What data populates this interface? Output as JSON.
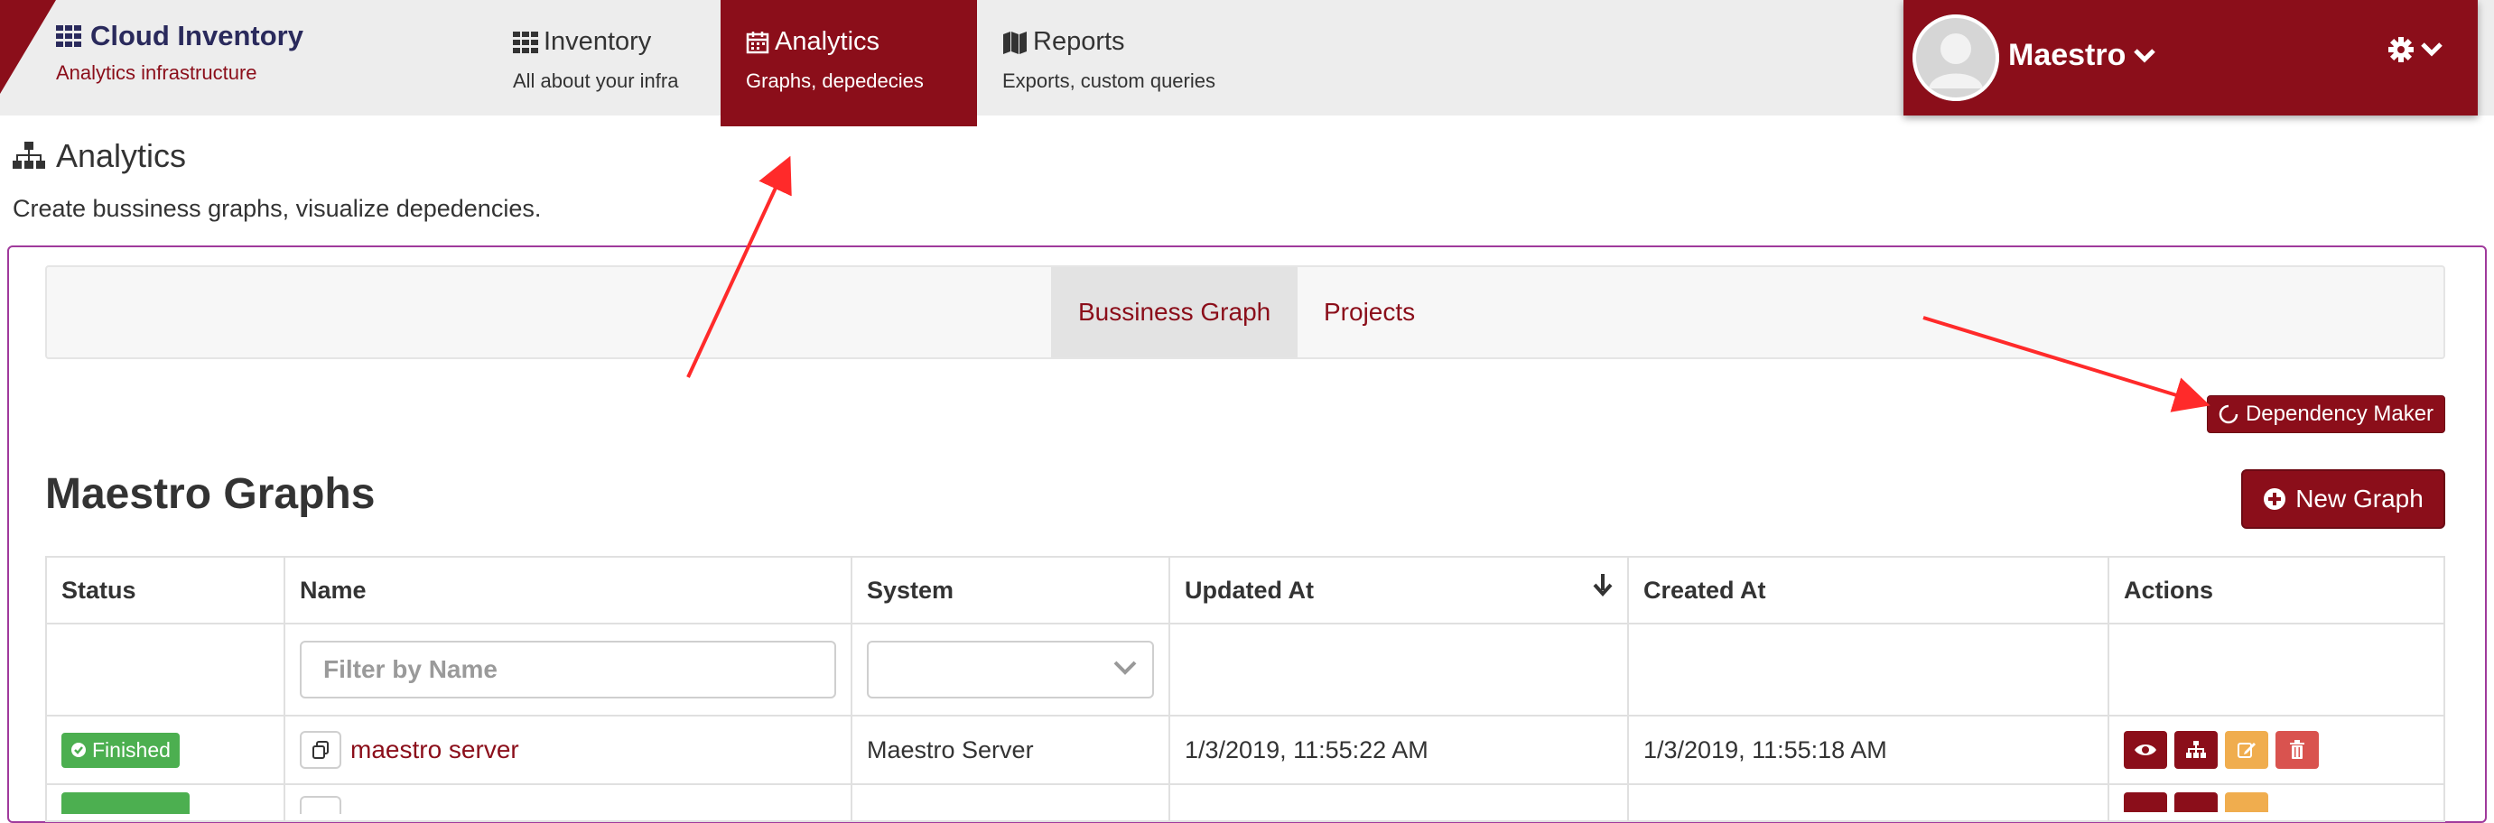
{
  "brand": {
    "title": "Cloud Inventory",
    "subtitle": "Analytics infrastructure"
  },
  "nav": [
    {
      "title": "Inventory",
      "subtitle": "All about your infra",
      "icon": "grid-icon"
    },
    {
      "title": "Analytics",
      "subtitle": "Graphs, depedecies",
      "icon": "calendar-icon",
      "active": true
    },
    {
      "title": "Reports",
      "subtitle": "Exports, custom queries",
      "icon": "map-icon"
    }
  ],
  "user": {
    "name": "Maestro"
  },
  "page": {
    "title": "Analytics",
    "description": "Create bussiness graphs, visualize depedencies."
  },
  "tabs": [
    {
      "label": "Bussiness Graph",
      "active": true
    },
    {
      "label": "Projects"
    }
  ],
  "dependency_button": "Dependency Maker",
  "graphs": {
    "title": "Maestro Graphs",
    "new_button": "New Graph",
    "columns": [
      "Status",
      "Name",
      "System",
      "Updated At",
      "Created At",
      "Actions"
    ],
    "filter_placeholder": "Filter by Name",
    "rows": [
      {
        "status": "Finished",
        "name": "maestro server",
        "system": "Maestro Server",
        "updated": "1/3/2019, 11:55:22 AM",
        "created": "1/3/2019, 11:55:18 AM"
      }
    ]
  },
  "colors": {
    "brand": "#8b0e1a",
    "success": "#4caf50",
    "warning": "#f0ad4e",
    "danger": "#d9534f",
    "annotation": "#ff2a2a"
  }
}
